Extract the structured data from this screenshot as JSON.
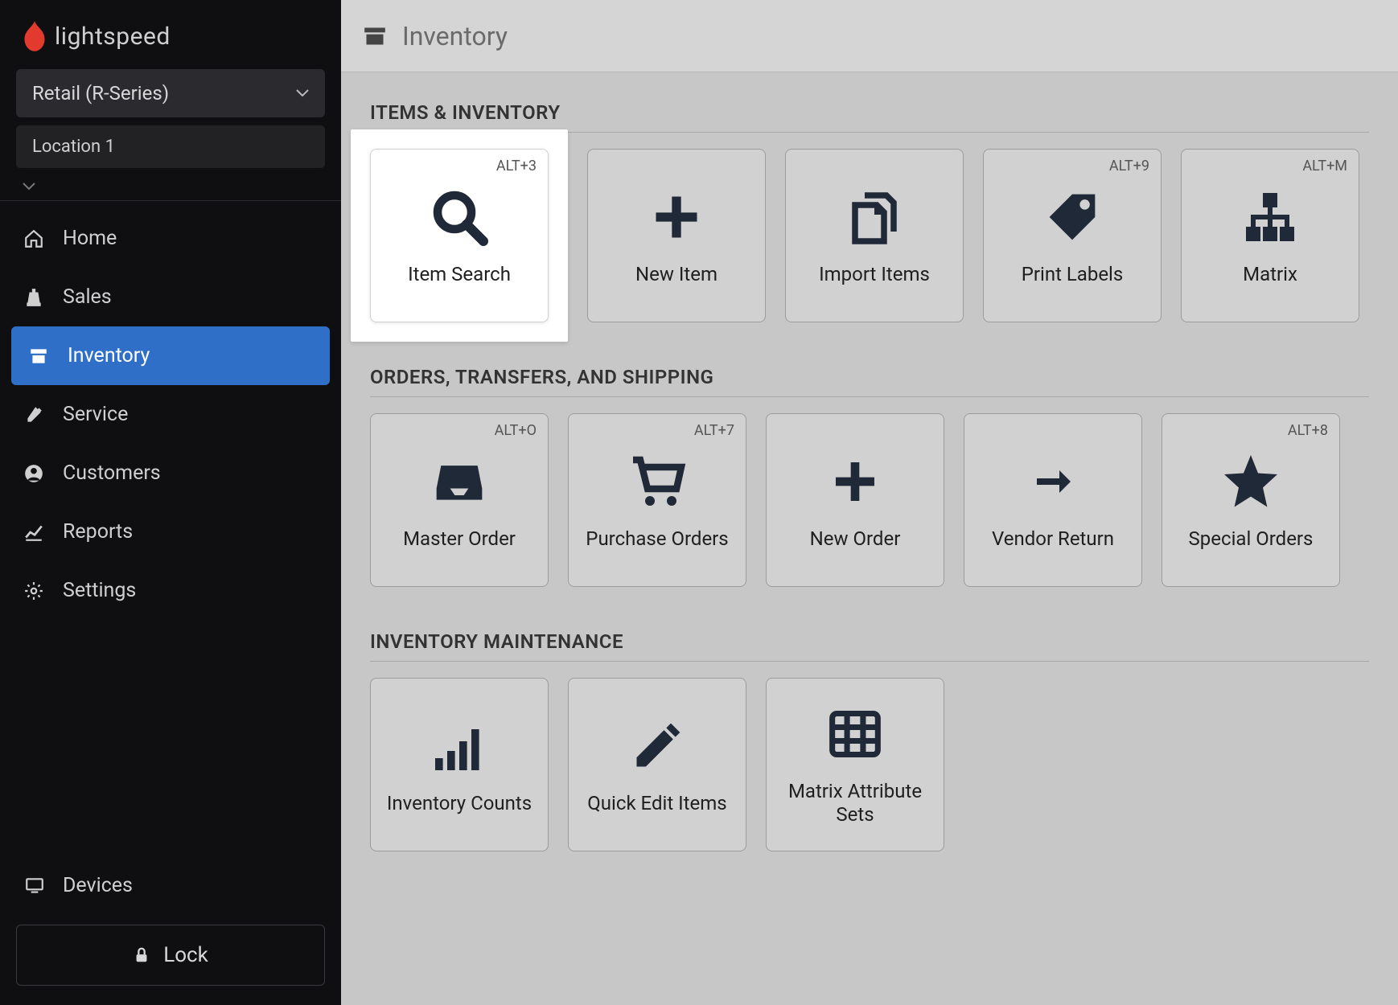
{
  "brand": {
    "name": "lightspeed"
  },
  "series": {
    "label": "Retail (R-Series)"
  },
  "location": {
    "label": "Location 1"
  },
  "nav": {
    "home": "Home",
    "sales": "Sales",
    "inventory": "Inventory",
    "service": "Service",
    "customers": "Customers",
    "reports": "Reports",
    "settings": "Settings"
  },
  "devices": {
    "label": "Devices"
  },
  "lock": {
    "label": "Lock"
  },
  "header": {
    "title": "Inventory"
  },
  "sections": {
    "items": {
      "title": "ITEMS & INVENTORY",
      "tiles": {
        "item_search": {
          "label": "Item Search",
          "shortcut": "ALT+3"
        },
        "new_item": {
          "label": "New Item",
          "shortcut": ""
        },
        "import_items": {
          "label": "Import Items",
          "shortcut": ""
        },
        "print_labels": {
          "label": "Print Labels",
          "shortcut": "ALT+9"
        },
        "matrix": {
          "label": "Matrix",
          "shortcut": "ALT+M"
        }
      }
    },
    "orders": {
      "title": "ORDERS, TRANSFERS, AND SHIPPING",
      "tiles": {
        "master_order": {
          "label": "Master Order",
          "shortcut": "ALT+O"
        },
        "purchase_orders": {
          "label": "Purchase Orders",
          "shortcut": "ALT+7"
        },
        "new_order": {
          "label": "New Order",
          "shortcut": ""
        },
        "vendor_return": {
          "label": "Vendor Return",
          "shortcut": ""
        },
        "special_orders": {
          "label": "Special Orders",
          "shortcut": "ALT+8"
        }
      }
    },
    "maintenance": {
      "title": "INVENTORY MAINTENANCE",
      "tiles": {
        "inventory_counts": {
          "label": "Inventory Counts",
          "shortcut": ""
        },
        "quick_edit": {
          "label": "Quick Edit Items",
          "shortcut": ""
        },
        "matrix_sets": {
          "label": "Matrix Attribute Sets",
          "shortcut": ""
        }
      }
    }
  }
}
